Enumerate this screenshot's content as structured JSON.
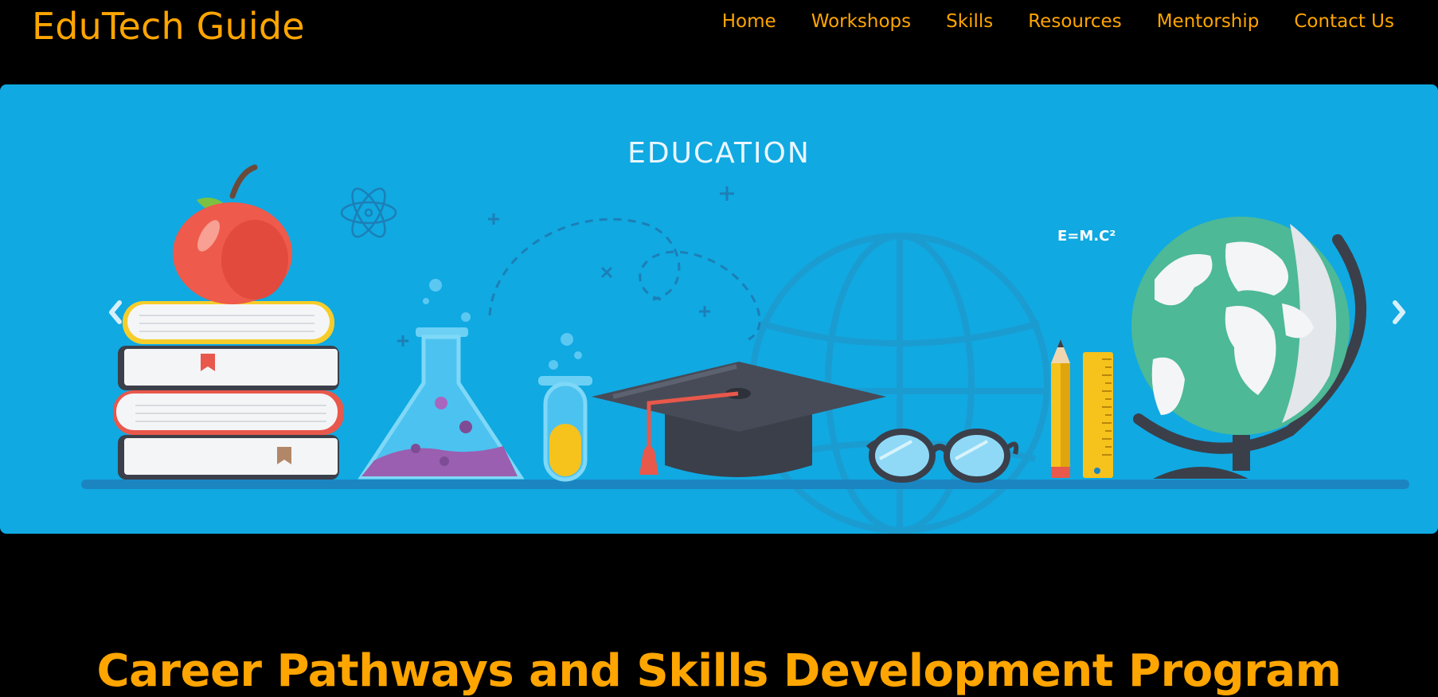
{
  "brand": {
    "name": "EduTech Guide"
  },
  "nav": {
    "links": [
      "Home",
      "Workshops",
      "Skills",
      "Resources",
      "Mentorship",
      "Contact Us"
    ]
  },
  "carousel": {
    "caption": "EDUCATION",
    "formula": "E=M.C²",
    "prev_icon": "chevron-left-icon",
    "next_icon": "chevron-right-icon"
  },
  "main": {
    "heading": "Career Pathways and Skills Development Program"
  },
  "colors": {
    "accent": "#FFA500",
    "banner": "#10A9E2",
    "background": "#000000"
  }
}
